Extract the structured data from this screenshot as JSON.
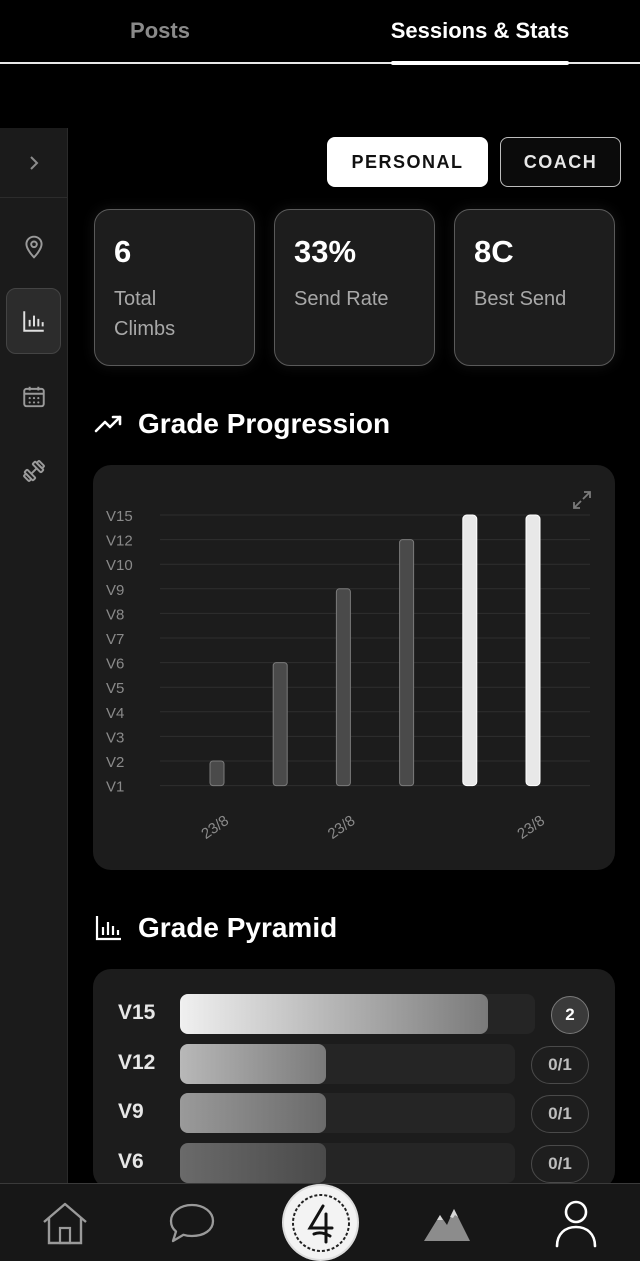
{
  "tabs": [
    {
      "label": "Posts",
      "active": false
    },
    {
      "label": "Sessions & Stats",
      "active": true
    }
  ],
  "rail": {
    "toggle_icon": "chevron-right-icon",
    "items": [
      {
        "icon": "location-pin-icon",
        "active": false
      },
      {
        "icon": "bar-chart-icon",
        "active": true
      },
      {
        "icon": "calendar-icon",
        "active": false
      },
      {
        "icon": "dumbbell-icon",
        "active": false
      }
    ]
  },
  "mode": {
    "personal_label": "PERSONAL",
    "coach_label": "COACH",
    "selected": "personal"
  },
  "stats": [
    {
      "value": "6",
      "label": "Total Climbs"
    },
    {
      "value": "33%",
      "label": "Send Rate"
    },
    {
      "value": "8C",
      "label": "Best Send"
    }
  ],
  "progression": {
    "title": "Grade Progression",
    "icon": "trending-up-icon"
  },
  "chart_data": {
    "type": "bar",
    "title": "",
    "xlabel": "",
    "ylabel": "",
    "y_ticks": [
      "V1",
      "V2",
      "V3",
      "V4",
      "V5",
      "V6",
      "V7",
      "V8",
      "V9",
      "V10",
      "V12",
      "V15"
    ],
    "x_tick_labels": [
      "23/8",
      "",
      "23/8",
      "",
      "",
      "23/8"
    ],
    "values": [
      "V2",
      "V6",
      "V9",
      "V12",
      "V15",
      "V15"
    ],
    "highlight": [
      false,
      false,
      false,
      false,
      true,
      true
    ],
    "grid": true,
    "colors": {
      "bar": "#4a4a4a",
      "bar_edge": "#7a7a7a",
      "highlight": "#e8e8e8",
      "grid": "#2e2e2e",
      "tick": "#8a8a8a"
    }
  },
  "pyramid": {
    "title": "Grade Pyramid",
    "icon": "bar-chart-icon",
    "rows": [
      {
        "grade": "V15",
        "count": "2",
        "fraction": 1.0,
        "highlight": true
      },
      {
        "grade": "V12",
        "count": "0/1",
        "fraction": 0.5,
        "highlight": false
      },
      {
        "grade": "V9",
        "count": "0/1",
        "fraction": 0.5,
        "highlight": false
      },
      {
        "grade": "V6",
        "count": "0/1",
        "fraction": 0.5,
        "highlight": false
      }
    ]
  },
  "bottom_nav": [
    {
      "icon": "home-icon"
    },
    {
      "icon": "chat-bubble-icon"
    },
    {
      "icon": "logo-icon"
    },
    {
      "icon": "mountain-icon"
    },
    {
      "icon": "profile-icon"
    }
  ]
}
